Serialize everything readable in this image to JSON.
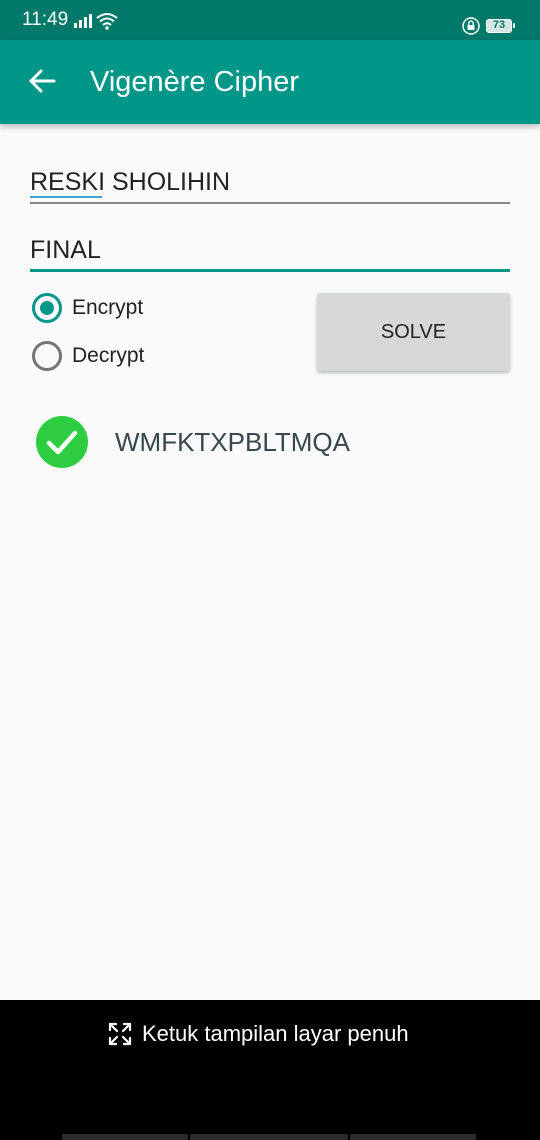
{
  "status_bar": {
    "time": "11:49",
    "network": "4G",
    "battery": "73",
    "icons": [
      "signal-icon",
      "wifi-icon",
      "lock-icon",
      "battery-icon"
    ]
  },
  "app_bar": {
    "title": "Vigenère Cipher",
    "back_icon": "arrow-left-icon",
    "color": "#009688",
    "status_color": "#00796b"
  },
  "form": {
    "plaintext_value": "RESKI SHOLIHIN",
    "key_value": "FINAL",
    "mode_options": [
      {
        "label": "Encrypt",
        "selected": true
      },
      {
        "label": "Decrypt",
        "selected": false
      }
    ],
    "solve_label": "SOLVE"
  },
  "result": {
    "icon": "check-circle-icon",
    "icon_color": "#2ecc40",
    "text": "WMFKTXPBLTMQA"
  },
  "overlay": {
    "icon": "expand-icon",
    "label": "Ketuk tampilan layar penuh"
  }
}
